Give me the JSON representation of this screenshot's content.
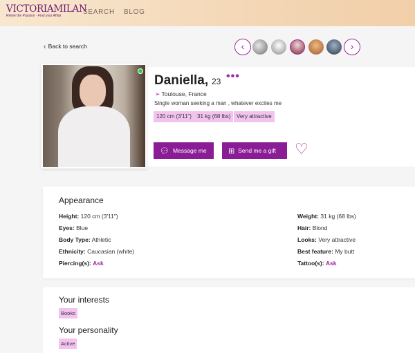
{
  "header": {
    "logo_text": "VICTORIAMILAN",
    "logo_tagline": "Relive the Passion · Find your Affair",
    "nav": [
      "SEARCH",
      "BLOG"
    ]
  },
  "back_link": "Back to search",
  "photo_strip": {
    "prev_icon": "chevron-left-icon",
    "next_icon": "chevron-right-icon"
  },
  "profile": {
    "name": "Daniella,",
    "age": "23",
    "more": "•••",
    "location": "Toulouse, France",
    "bio": "Single woman seeking a man , whatever excites me",
    "tags": [
      "120 cm (3'11\")",
      "31 kg (68 lbs)",
      "Very attractive"
    ],
    "online": true,
    "message_button": "Message me",
    "gift_button": "Send me a gift"
  },
  "appearance": {
    "title": "Appearance",
    "left": [
      {
        "label": "Height:",
        "value": "120 cm (3'11\")"
      },
      {
        "label": "Eyes:",
        "value": "Blue"
      },
      {
        "label": "Body Type:",
        "value": "Athletic"
      },
      {
        "label": "Ethnicity:",
        "value": "Caucasian (white)"
      },
      {
        "label": "Piercing(s):",
        "value": "Ask"
      }
    ],
    "right": [
      {
        "label": "Weight:",
        "value": "31 kg (68 lbs)"
      },
      {
        "label": "Hair:",
        "value": "Blond"
      },
      {
        "label": "Looks:",
        "value": "Very attractive"
      },
      {
        "label": "Best feature:",
        "value": "My butt"
      },
      {
        "label": "Tattoo(s):",
        "value": "Ask"
      }
    ]
  },
  "interests": {
    "title": "Your interests",
    "tags": [
      "Books"
    ],
    "personality_title": "Your personality",
    "personality_tags": [
      "Active"
    ]
  },
  "colors": {
    "accent": "#a0279f",
    "button": "#8a1c95",
    "tag_bg": "#f3c3ef",
    "online": "#2ecc40"
  }
}
